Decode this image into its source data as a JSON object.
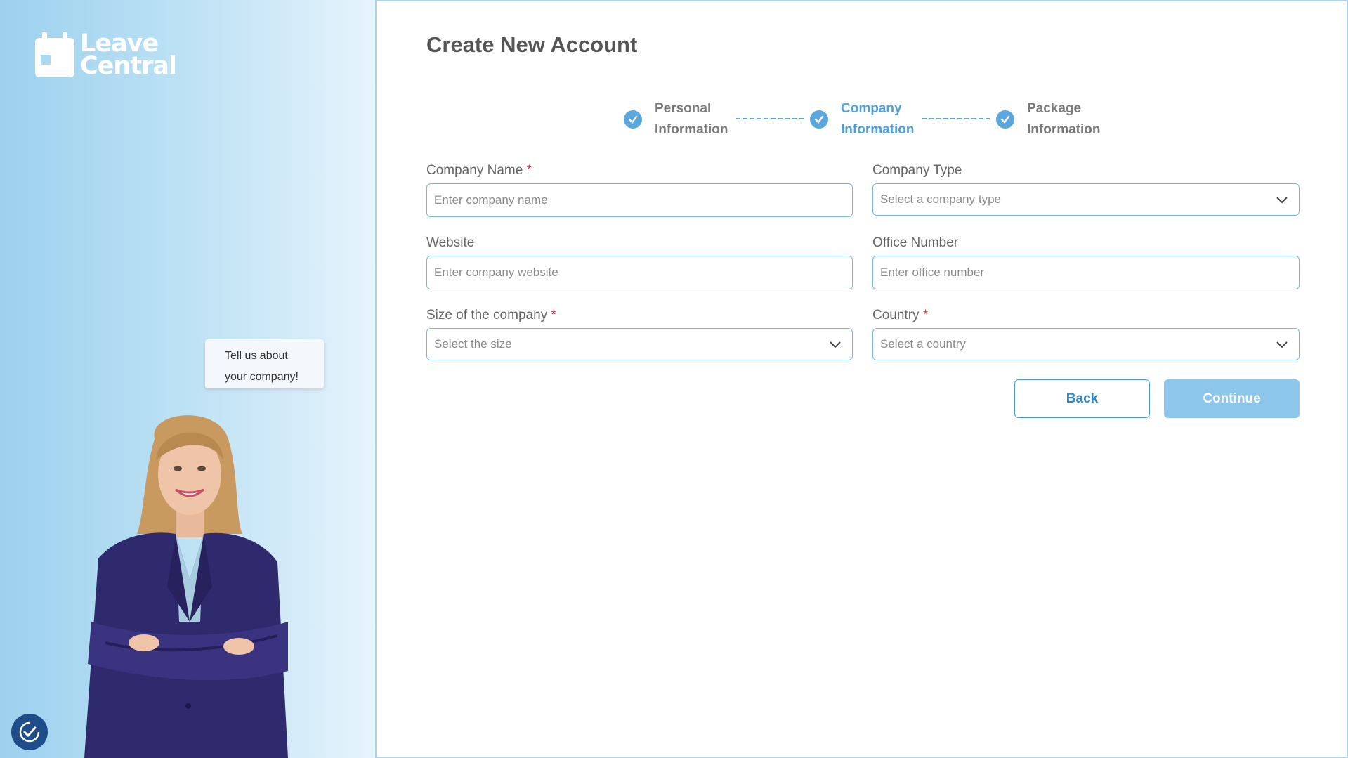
{
  "brand": {
    "line1": "Leave",
    "line2": "Central",
    "logo_icon": "calendar-icon"
  },
  "sidebar": {
    "speech_line1": "Tell us about",
    "speech_line2": "your company!",
    "badge_icon": "accessibility-check-icon"
  },
  "page": {
    "title": "Create New Account"
  },
  "stepper": {
    "steps": [
      {
        "line1": "Personal",
        "line2": "Information",
        "state": "completed"
      },
      {
        "line1": "Company",
        "line2": "Information",
        "state": "active"
      },
      {
        "line1": "Package",
        "line2": "Information",
        "state": "completed"
      }
    ]
  },
  "form": {
    "company_name": {
      "label": "Company Name",
      "required": "*",
      "placeholder": "Enter company name",
      "value": ""
    },
    "company_type": {
      "label": "Company Type",
      "placeholder": "Select a company type"
    },
    "website": {
      "label": "Website",
      "placeholder": "Enter company website",
      "value": ""
    },
    "office_number": {
      "label": "Office Number",
      "placeholder": "Enter office number",
      "value": ""
    },
    "company_size": {
      "label": "Size of the company",
      "required": "*",
      "placeholder": "Select the size"
    },
    "country": {
      "label": "Country",
      "required": "*",
      "placeholder": "Select a country"
    }
  },
  "actions": {
    "back_label": "Back",
    "continue_label": "Continue"
  },
  "colors": {
    "accent": "#4ea0d9",
    "continue_disabled": "#8cc6ea",
    "required": "#e0393e",
    "badge": "#1f4d8a"
  }
}
